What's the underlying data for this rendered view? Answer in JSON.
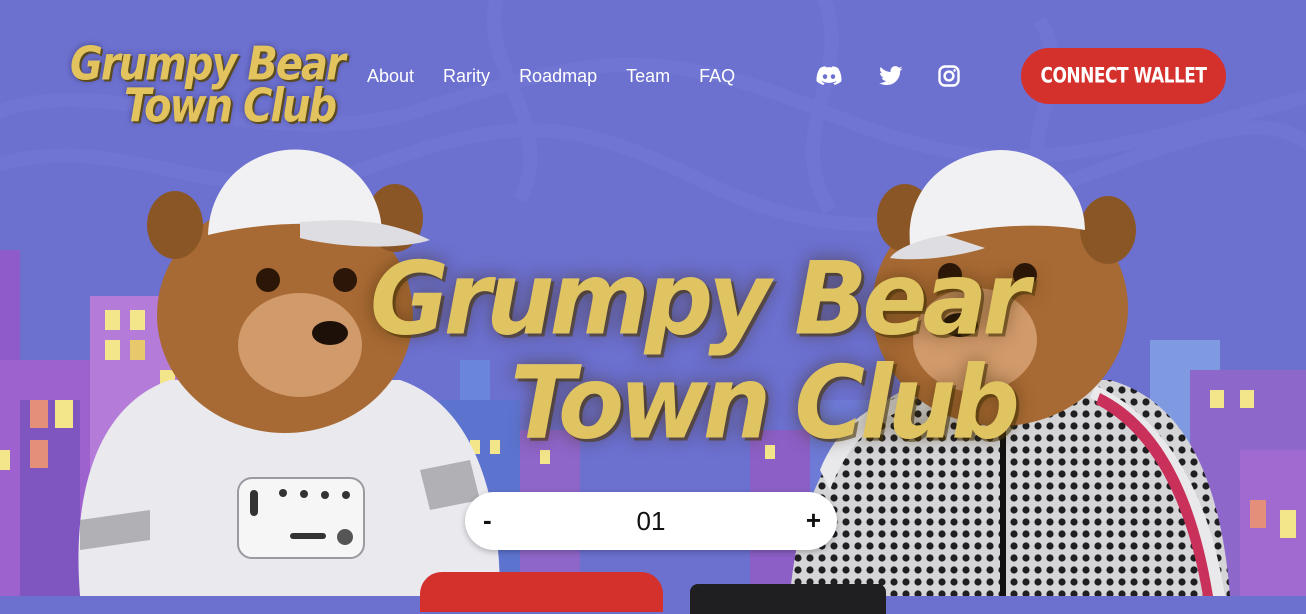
{
  "brand": {
    "logo_line1": "Grumpy Bear",
    "logo_line2": "Town Club",
    "accent_gold": "#e1c462",
    "accent_red": "#d4302c",
    "background": "#6c70cf"
  },
  "nav": {
    "items": [
      {
        "label": "About"
      },
      {
        "label": "Rarity"
      },
      {
        "label": "Roadmap"
      },
      {
        "label": "Team"
      },
      {
        "label": "FAQ"
      }
    ]
  },
  "social": {
    "icons": [
      "discord-icon",
      "twitter-icon",
      "instagram-icon"
    ]
  },
  "header": {
    "connect_label": "CONNECT WALLET"
  },
  "hero": {
    "title_line1": "Grumpy Bear",
    "title_line2": "Town Club"
  },
  "mint": {
    "minus_label": "-",
    "quantity": "01",
    "plus_label": "+"
  }
}
